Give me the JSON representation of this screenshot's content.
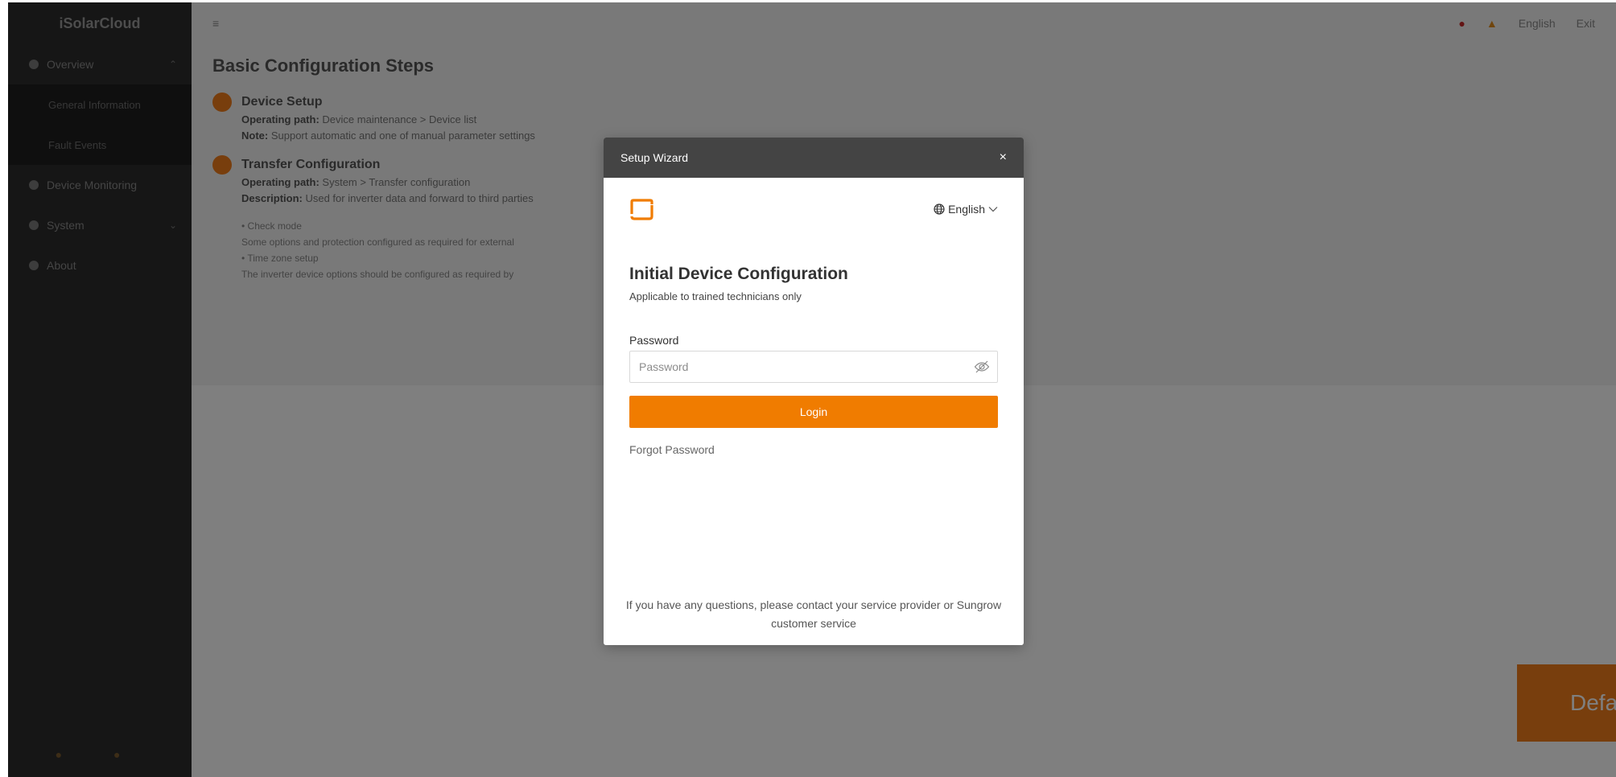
{
  "background": {
    "sidebar": {
      "logo": "iSolarCloud",
      "items": [
        {
          "label": "Overview",
          "caret": "⌃"
        },
        {
          "label": "General Information",
          "sub": true
        },
        {
          "label": "Fault Events",
          "sub": true
        },
        {
          "label": "Device Monitoring"
        },
        {
          "label": "System",
          "caret": "⌄"
        },
        {
          "label": "About"
        }
      ]
    },
    "topbar": {
      "menu_icon": "≡",
      "right_items": [
        "●",
        "▲",
        "English",
        "Exit"
      ]
    },
    "content": {
      "title": "Basic Configuration Steps",
      "steps": [
        {
          "title": "Device Setup",
          "lines": [
            [
              "Operating path:",
              "Device maintenance > Device list"
            ],
            [
              "Note:",
              "Support automatic and one of manual parameter settings"
            ]
          ]
        },
        {
          "title": "Transfer Configuration",
          "lines": [
            [
              "Operating path:",
              "System > Transfer configuration"
            ],
            [
              "Description:",
              "Used for inverter data and forward to third parties"
            ]
          ]
        }
      ],
      "bullets": [
        "• Check mode",
        "Some options and protection configured as required for external",
        "• Time zone setup",
        "The inverter device options should be configured as required by"
      ]
    },
    "cta_label": "Default"
  },
  "modal": {
    "title": "Setup Wizard",
    "close_label": "×",
    "language": "English",
    "heading": "Initial Device Configuration",
    "subheading": "Applicable to trained technicians only",
    "password_label": "Password",
    "password_placeholder": "Password",
    "login_label": "Login",
    "forgot_label": "Forgot Password",
    "footer_line1": "If you have any questions, please contact your service provider or Sungrow",
    "footer_line2": "customer service"
  },
  "colors": {
    "accent": "#f07c00",
    "modal_header": "#444444",
    "overlay": "rgba(0,0,0,0.5)"
  },
  "icons": {
    "brand": "sungrow-logo-icon",
    "language": "globe-icon",
    "language_caret": "chevron-down-icon",
    "password_toggle": "eye-off-icon",
    "close": "close-icon"
  }
}
